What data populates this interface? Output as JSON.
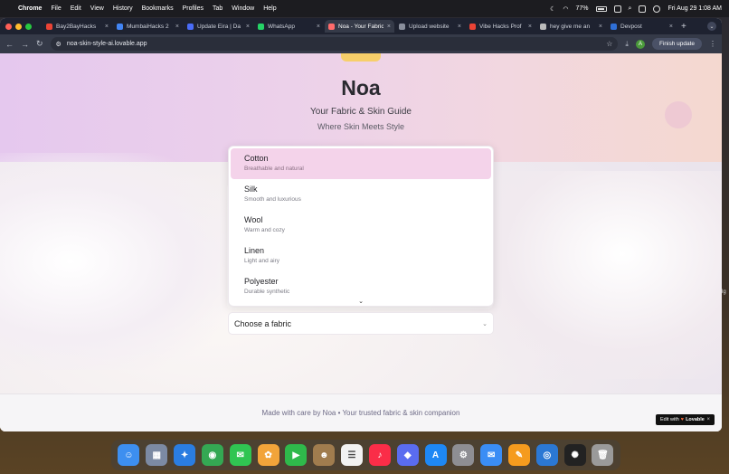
{
  "menubar": {
    "app": "Chrome",
    "items": [
      "File",
      "Edit",
      "View",
      "History",
      "Bookmarks",
      "Profiles",
      "Tab",
      "Window",
      "Help"
    ],
    "battery": "77%",
    "datetime": "Fri Aug 29  1:08 AM"
  },
  "tabs": [
    {
      "title": "Bay2BayHacks",
      "favicon": "gmail-icon",
      "color": "#ea4335"
    },
    {
      "title": "MumbaiHacks 2",
      "favicon": "docs-icon",
      "color": "#4285f4"
    },
    {
      "title": "Update Eira | Da",
      "favicon": "docs-icon",
      "color": "#4a6cf7"
    },
    {
      "title": "WhatsApp",
      "favicon": "whatsapp-icon",
      "color": "#25d366"
    },
    {
      "title": "Noa - Your Fabric",
      "favicon": "lovable-icon",
      "color": "#ff6b6b",
      "active": true
    },
    {
      "title": "Upload website",
      "favicon": "globe-icon",
      "color": "#8a8f9c"
    },
    {
      "title": "Vibe Hacks Prof",
      "favicon": "gmail-icon",
      "color": "#ea4335"
    },
    {
      "title": "hey give me an",
      "favicon": "chatgpt-icon",
      "color": "#bbbbbb"
    },
    {
      "title": "Devpost",
      "favicon": "devpost-icon",
      "color": "#2f6fd6"
    }
  ],
  "toolbar": {
    "url": "noa-skin-style-ai.lovable.app",
    "profile_initial": "A",
    "finish_update": "Finish update"
  },
  "page": {
    "title": "Noa",
    "tagline": "Your Fabric & Skin Guide",
    "subtitle": "Where Skin Meets Style",
    "dropdown": {
      "options": [
        {
          "name": "Cotton",
          "desc": "Breathable and natural",
          "selected": true
        },
        {
          "name": "Silk",
          "desc": "Smooth and luxurious"
        },
        {
          "name": "Wool",
          "desc": "Warm and cozy"
        },
        {
          "name": "Linen",
          "desc": "Light and airy"
        },
        {
          "name": "Polyester",
          "desc": "Durable synthetic"
        }
      ],
      "placeholder": "Choose a fabric"
    },
    "footer": "Made with care by Noa • Your trusted fabric & skin companion",
    "badge": "Edit with",
    "badge_brand": "Lovable"
  },
  "dock": [
    {
      "name": "finder",
      "color": "#3d8ff0",
      "glyph": "☺"
    },
    {
      "name": "launchpad",
      "color": "#7c8aa3",
      "glyph": "▦"
    },
    {
      "name": "safari",
      "color": "#2a7de1",
      "glyph": "✦"
    },
    {
      "name": "chrome",
      "color": "#34a853",
      "glyph": "◉"
    },
    {
      "name": "messages",
      "color": "#30c552",
      "glyph": "✉"
    },
    {
      "name": "photos",
      "color": "#f2a43a",
      "glyph": "✿"
    },
    {
      "name": "facetime",
      "color": "#2fb94b",
      "glyph": "▶"
    },
    {
      "name": "contacts",
      "color": "#a07c4e",
      "glyph": "☻"
    },
    {
      "name": "reminders",
      "color": "#f2f2f2",
      "glyph": "☰"
    },
    {
      "name": "music",
      "color": "#fa2d48",
      "glyph": "♪"
    },
    {
      "name": "games",
      "color": "#5a6cf0",
      "glyph": "◆"
    },
    {
      "name": "app-store",
      "color": "#1e88f5",
      "glyph": "A"
    },
    {
      "name": "system-settings",
      "color": "#8e8e93",
      "glyph": "⚙"
    },
    {
      "name": "mail",
      "color": "#3a8df5",
      "glyph": "✉"
    },
    {
      "name": "pages",
      "color": "#f59b1e",
      "glyph": "✎"
    },
    {
      "name": "proxyman",
      "color": "#2b78d4",
      "glyph": "◎"
    },
    {
      "name": "chatgpt",
      "color": "#222222",
      "glyph": "✺"
    },
    {
      "name": "trash",
      "color": "#9a9a9a",
      "glyph": "🗑"
    }
  ]
}
